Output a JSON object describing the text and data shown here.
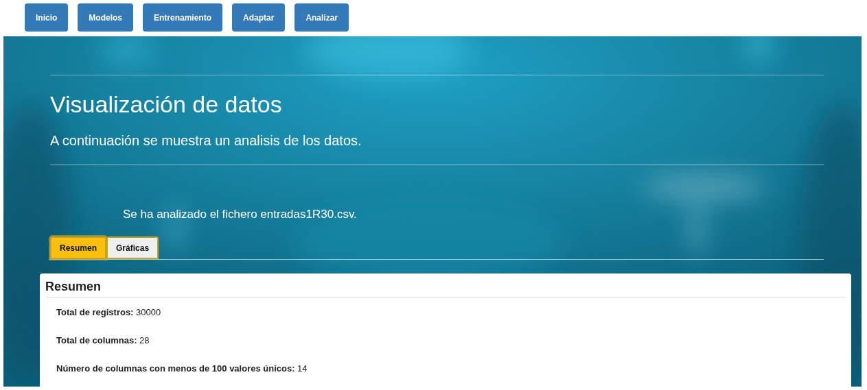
{
  "nav": [
    {
      "label": "Inicio"
    },
    {
      "label": "Modelos"
    },
    {
      "label": "Entrenamiento"
    },
    {
      "label": "Adaptar"
    },
    {
      "label": "Analizar"
    }
  ],
  "hero": {
    "title": "Visualización de datos",
    "subtitle": "A continuación se muestra un analisis de los datos.",
    "message": "Se ha analizado el fichero entradas1R30.csv."
  },
  "tabs": [
    {
      "label": "Resumen",
      "selected": true
    },
    {
      "label": "Gráficas",
      "selected": false
    }
  ],
  "panel": {
    "title": "Resumen",
    "stats": [
      "**Total de registros:** 30000",
      "**Total de columnas:** 28",
      "**Número de columnas con menos de 100 valores únicos:** 14"
    ]
  }
}
